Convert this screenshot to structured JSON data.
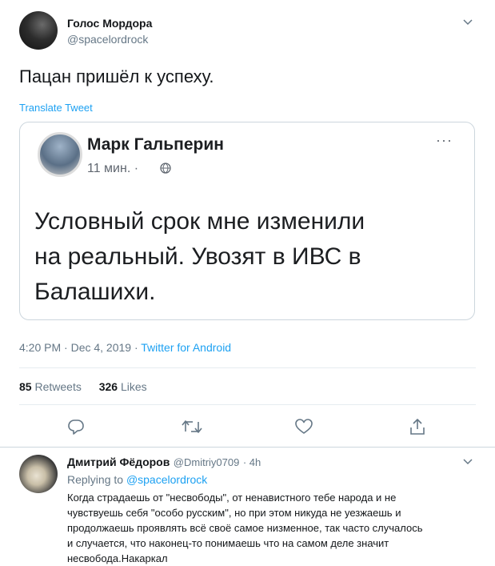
{
  "tweet": {
    "author_name": "Голос Мордора",
    "author_handle": "@spacelordrock",
    "text": "Пацан пришёл к успеху.",
    "translate_label": "Translate Tweet",
    "time": "4:20 PM · Dec 4, 2019 · ",
    "source": "Twitter for Android",
    "retweets_count": "85",
    "retweets_label": "Retweets",
    "likes_count": "326",
    "likes_label": "Likes"
  },
  "embedded_post": {
    "author_name": "Марк Гальперин",
    "time": "11 мин. ·",
    "more": "···",
    "text_lines": [
      "Условный срок мне изменили",
      "на реальный. Увозят в ИВС в",
      "Балашихи."
    ]
  },
  "reply": {
    "author_name": "Дмитрий Фёдоров",
    "author_handle": "@Dmitriy0709",
    "time": "· 4h",
    "replying_prefix": "Replying to ",
    "replying_to": "@spacelordrock",
    "text_lines": [
      "Когда страдаешь от \"несвободы\", от ненавистного тебе народа и не",
      "чувствуешь себя \"особо русским\", но при этом никуда не уезжаешь и",
      "продолжаешь проявлять всё своё самое низменное, так часто случалось",
      "и случается, что наконец-то понимаешь что на самом деле значит",
      "несвобода.Накаркал"
    ]
  },
  "icons": {
    "caret": "chevron-down-icon",
    "reply": "reply-icon",
    "retweet": "retweet-icon",
    "like": "heart-icon",
    "share": "share-icon",
    "globe": "globe-icon"
  },
  "colors": {
    "link": "#1da1f2",
    "muted": "#657786",
    "border": "#e6ecf0"
  }
}
